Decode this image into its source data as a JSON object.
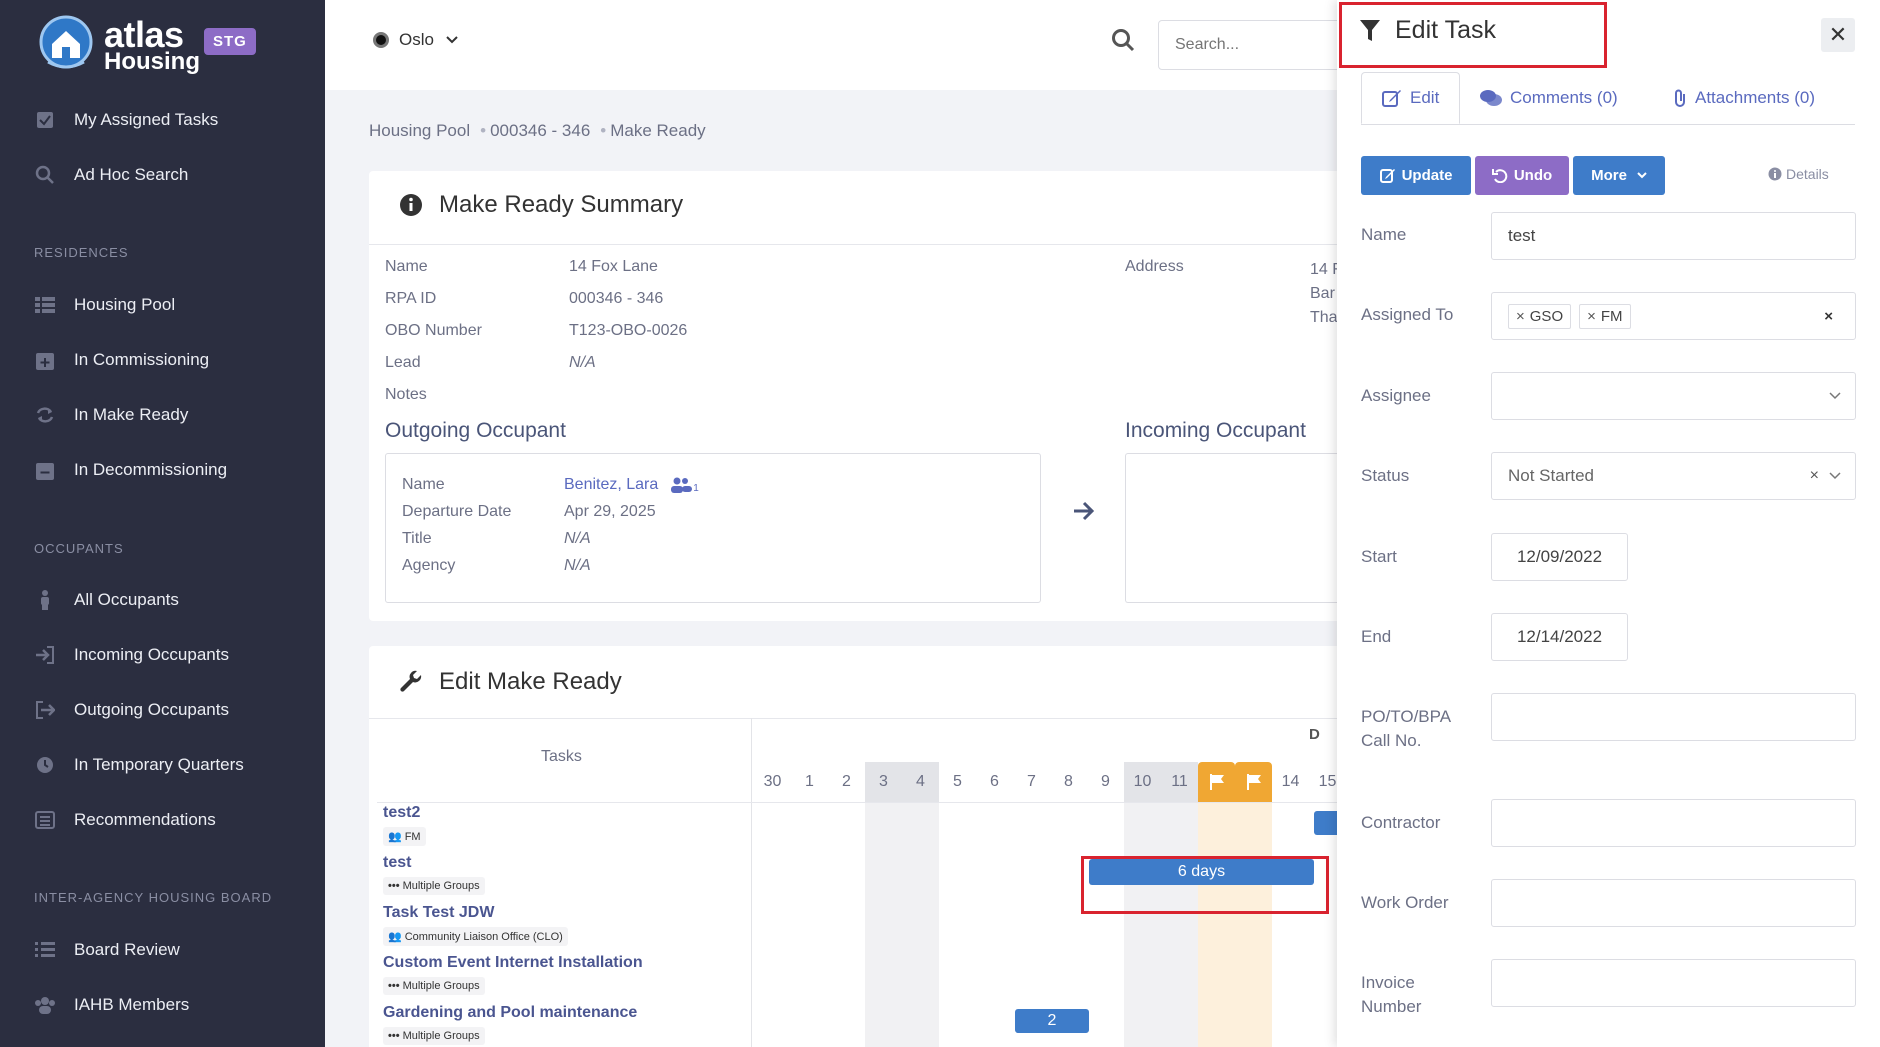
{
  "app": {
    "logo_word1": "atlas",
    "logo_word2": "Housing",
    "logo_badge": "STG"
  },
  "sidebar": {
    "top_items": [
      {
        "label": "My Assigned Tasks",
        "icon": "checkbox-icon"
      },
      {
        "label": "Ad Hoc Search",
        "icon": "search-icon"
      }
    ],
    "residences_heading": "RESIDENCES",
    "residences": [
      {
        "label": "Housing Pool",
        "icon": "list-icon"
      },
      {
        "label": "In Commissioning",
        "icon": "calendar-plus-icon"
      },
      {
        "label": "In Make Ready",
        "icon": "refresh-icon"
      },
      {
        "label": "In Decommissioning",
        "icon": "calendar-minus-icon"
      }
    ],
    "occupants_heading": "OCCUPANTS",
    "occupants": [
      {
        "label": "All Occupants",
        "icon": "person-icon"
      },
      {
        "label": "Incoming Occupants",
        "icon": "sign-in-icon"
      },
      {
        "label": "Outgoing Occupants",
        "icon": "sign-out-icon"
      },
      {
        "label": "In Temporary Quarters",
        "icon": "clock-icon"
      },
      {
        "label": "Recommendations",
        "icon": "list-alt-icon"
      }
    ],
    "iahb_heading": "INTER-AGENCY HOUSING BOARD",
    "iahb": [
      {
        "label": "Board Review",
        "icon": "list-icon"
      },
      {
        "label": "IAHB Members",
        "icon": "users-icon"
      }
    ]
  },
  "topbar": {
    "post": "Oslo",
    "search_placeholder": "Search..."
  },
  "breadcrumb": [
    "Housing Pool",
    "000346 - 346",
    "Make Ready"
  ],
  "summary": {
    "title": "Make Ready Summary",
    "fields": [
      {
        "label": "Name",
        "value": "14 Fox Lane",
        "italic": false
      },
      {
        "label": "RPA ID",
        "value": "000346 - 346",
        "italic": false
      },
      {
        "label": "OBO Number",
        "value": "T123-OBO-0026",
        "italic": false
      },
      {
        "label": "Lead",
        "value": "N/A",
        "italic": true
      },
      {
        "label": "Notes",
        "value": "",
        "italic": false
      }
    ],
    "address_label": "Address",
    "address_lines": [
      "14 F",
      "Bar",
      "Tha"
    ],
    "outgoing_heading": "Outgoing Occupant",
    "incoming_heading": "Incoming Occupant",
    "outgoing": {
      "name_label": "Name",
      "name_value": "Benitez, Lara",
      "household_count": "1",
      "departure_label": "Departure Date",
      "departure_value": "Apr 29, 2025",
      "title_label": "Title",
      "title_value": "N/A",
      "agency_label": "Agency",
      "agency_value": "N/A"
    }
  },
  "edit_make_ready": {
    "title": "Edit Make Ready",
    "tasks_header": "Tasks",
    "month_letter": "D",
    "days": [
      "30",
      "1",
      "2",
      "3",
      "4",
      "5",
      "6",
      "7",
      "8",
      "9",
      "10",
      "11",
      "",
      "",
      "14",
      "15"
    ],
    "tasks": [
      {
        "name": "test2",
        "tag": "FM",
        "tag_icon": "users-icon"
      },
      {
        "name": "test",
        "tag": "Multiple Groups",
        "tag_icon": "ellipsis-icon"
      },
      {
        "name": "Task Test JDW",
        "tag": "Community Liaison Office (CLO)",
        "tag_icon": "users-icon"
      },
      {
        "name": "Custom Event Internet Installation",
        "tag": "Multiple Groups",
        "tag_icon": "ellipsis-icon"
      },
      {
        "name": "Gardening and Pool maintenance",
        "tag": "Multiple Groups",
        "tag_icon": "ellipsis-icon"
      }
    ],
    "bar_test_label": "6 days",
    "bar_gardening_label": "2"
  },
  "edit_task": {
    "title": "Edit Task",
    "tabs": [
      "Edit",
      "Comments (0)",
      "Attachments (0)"
    ],
    "buttons": {
      "update": "Update",
      "undo": "Undo",
      "more": "More"
    },
    "details_label": "Details",
    "fields": {
      "name_label": "Name",
      "name_value": "test",
      "assigned_to_label": "Assigned To",
      "assigned_chips": [
        "GSO",
        "FM"
      ],
      "assignee_label": "Assignee",
      "status_label": "Status",
      "status_value": "Not Started",
      "start_label": "Start",
      "start_value": "12/09/2022",
      "end_label": "End",
      "end_value": "12/14/2022",
      "po_label_1": "PO/TO/BPA",
      "po_label_2": "Call No.",
      "contractor_label": "Contractor",
      "work_order_label": "Work Order",
      "invoice_label_1": "Invoice",
      "invoice_label_2": "Number"
    }
  },
  "colors": {
    "sidebar_bg": "#2b2e40",
    "primary_blue": "#3e7cc9",
    "purple": "#8d6cc6",
    "flag_orange": "#f0a733",
    "highlight_red": "#d9232f"
  }
}
